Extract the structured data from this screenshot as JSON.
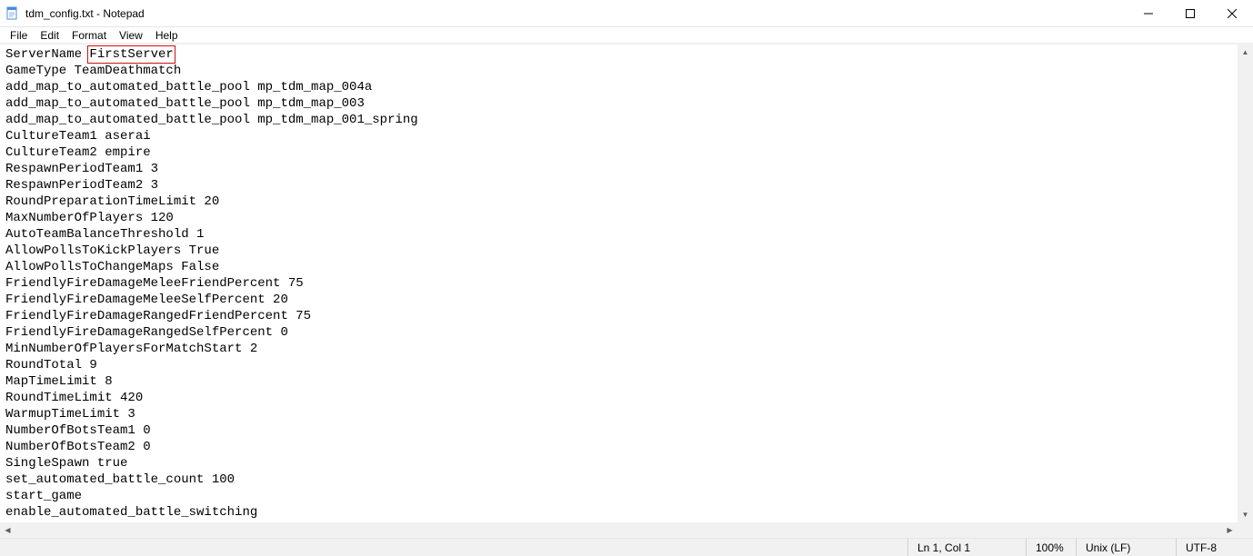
{
  "window": {
    "title": "tdm_config.txt - Notepad"
  },
  "menu": {
    "file": "File",
    "edit": "Edit",
    "format": "Format",
    "view": "View",
    "help": "Help"
  },
  "content": {
    "lines": [
      "ServerName FirstServer",
      "GameType TeamDeathmatch",
      "add_map_to_automated_battle_pool mp_tdm_map_004a",
      "add_map_to_automated_battle_pool mp_tdm_map_003",
      "add_map_to_automated_battle_pool mp_tdm_map_001_spring",
      "CultureTeam1 aserai",
      "CultureTeam2 empire",
      "RespawnPeriodTeam1 3",
      "RespawnPeriodTeam2 3",
      "RoundPreparationTimeLimit 20",
      "MaxNumberOfPlayers 120",
      "AutoTeamBalanceThreshold 1",
      "AllowPollsToKickPlayers True",
      "AllowPollsToChangeMaps False",
      "FriendlyFireDamageMeleeFriendPercent 75",
      "FriendlyFireDamageMeleeSelfPercent 20",
      "FriendlyFireDamageRangedFriendPercent 75",
      "FriendlyFireDamageRangedSelfPercent 0",
      "MinNumberOfPlayersForMatchStart 2",
      "RoundTotal 9",
      "MapTimeLimit 8",
      "RoundTimeLimit 420",
      "WarmupTimeLimit 3",
      "NumberOfBotsTeam1 0",
      "NumberOfBotsTeam2 0",
      "SingleSpawn true",
      "set_automated_battle_count 100",
      "start_game",
      "enable_automated_battle_switching"
    ]
  },
  "highlight": {
    "line": 0,
    "startCol": 11,
    "endCol": 22
  },
  "status": {
    "caret": "Ln 1, Col 1",
    "zoom": "100%",
    "eol": "Unix (LF)",
    "encoding": "UTF-8"
  }
}
